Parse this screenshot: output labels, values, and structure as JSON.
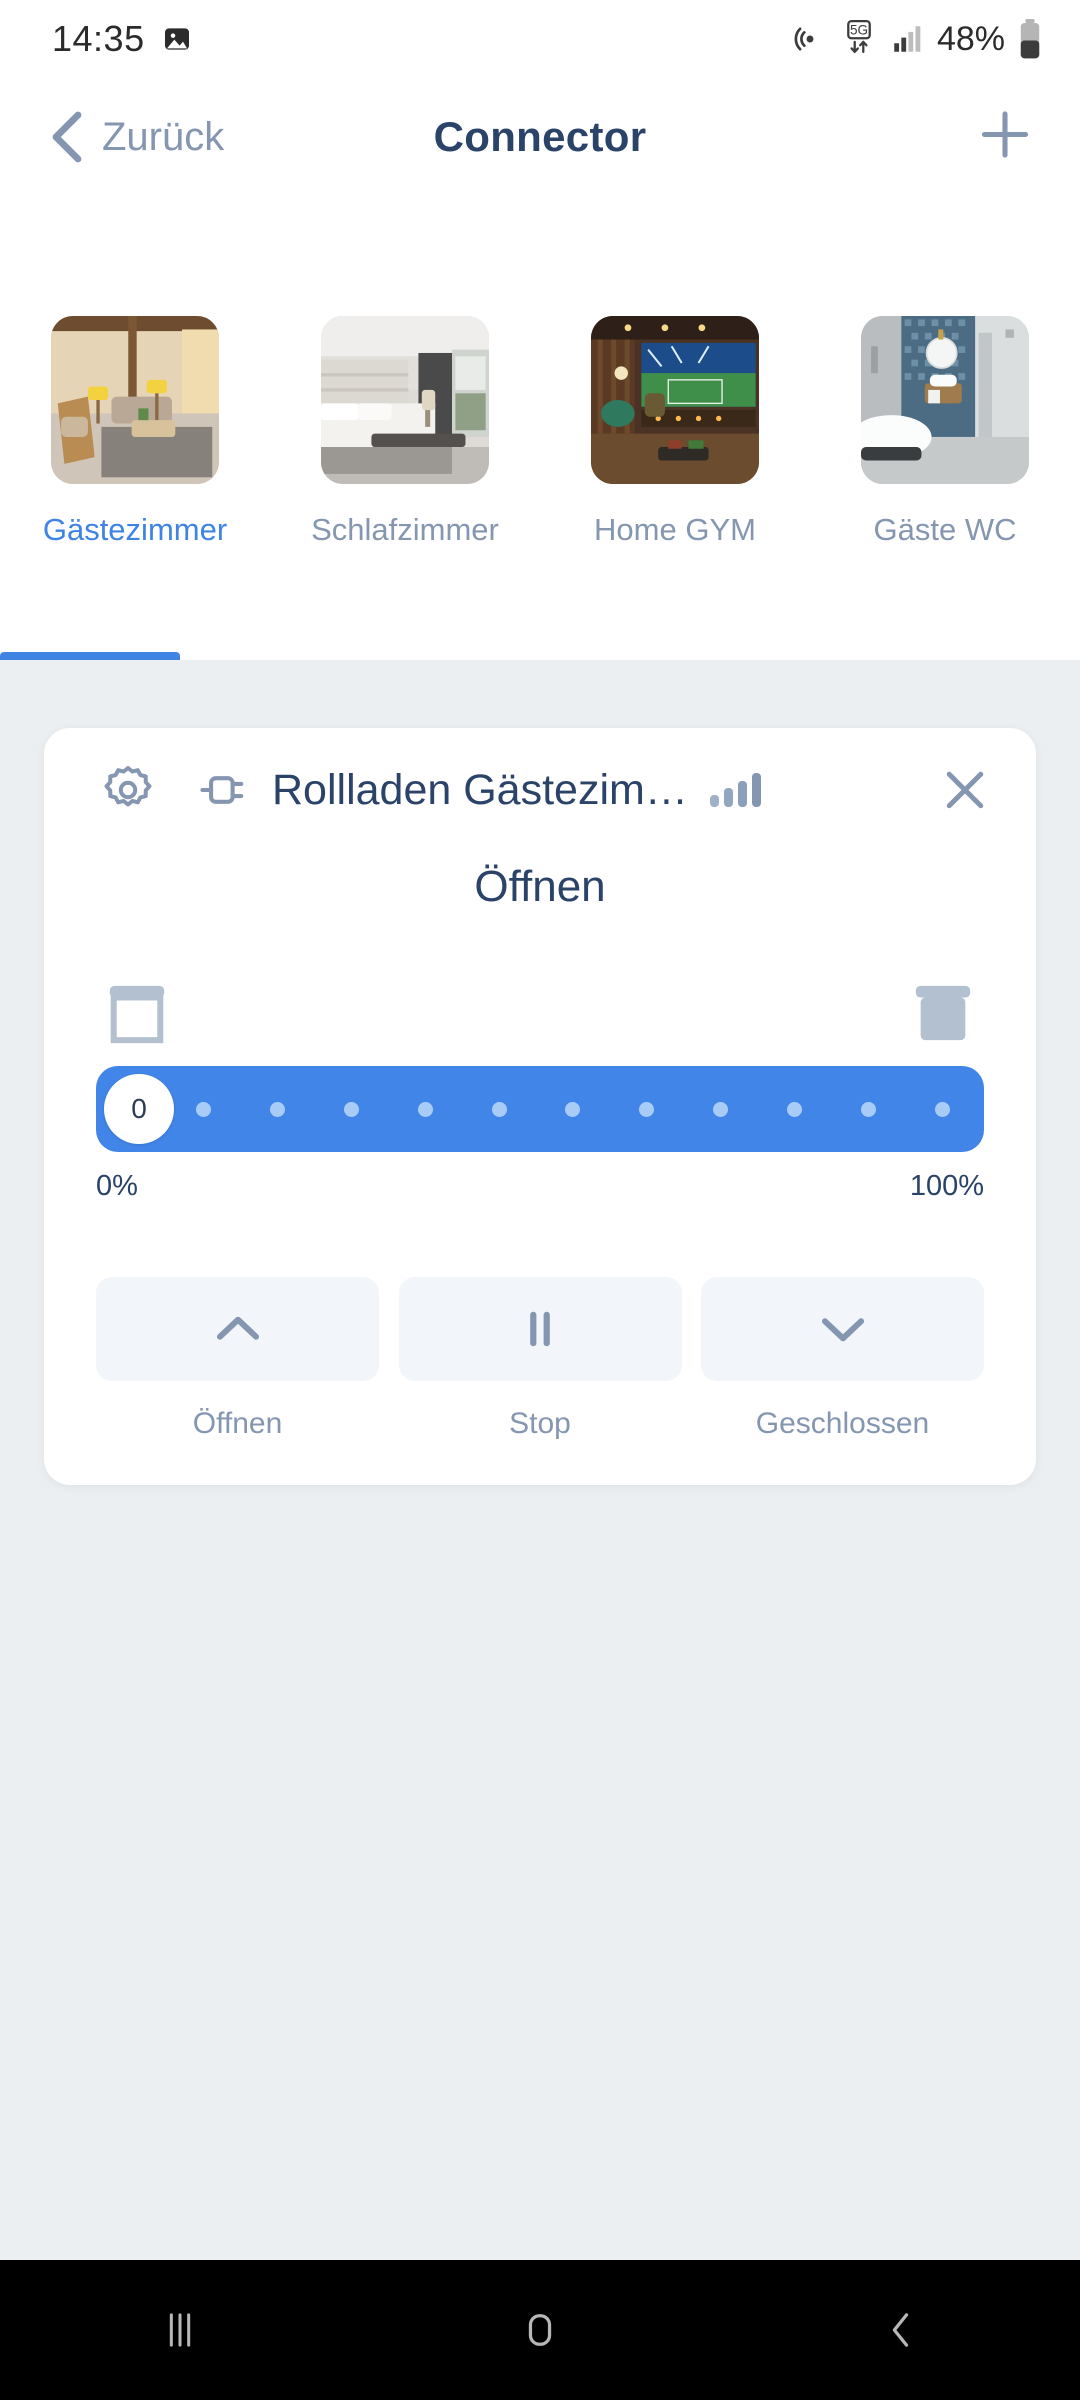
{
  "status_bar": {
    "time": "14:35",
    "battery_percent": "48%",
    "icons": [
      "image-icon",
      "hotspot-icon",
      "5g-icon",
      "signal-bars-icon",
      "battery-icon"
    ]
  },
  "header": {
    "back_label": "Zurück",
    "title": "Connector",
    "add_label": "+"
  },
  "rooms": [
    {
      "label": "Gästezimmer",
      "active": true,
      "thumb": "guest-room-photo"
    },
    {
      "label": "Schlafzimmer",
      "active": false,
      "thumb": "bedroom-photo"
    },
    {
      "label": "Home GYM",
      "active": false,
      "thumb": "home-gym-photo"
    },
    {
      "label": "Gäste WC",
      "active": false,
      "thumb": "guest-bathroom-photo"
    }
  ],
  "device_card": {
    "device_name": "Rollladen Gästezim…",
    "state_title": "Öffnen",
    "signal_bars": 4,
    "slider": {
      "value": "0",
      "min_label": "0%",
      "max_label": "100%",
      "tick_count": 11
    },
    "controls": [
      {
        "label": "Öffnen",
        "icon": "chevron-up-icon"
      },
      {
        "label": "Stop",
        "icon": "pause-icon"
      },
      {
        "label": "Geschlossen",
        "icon": "chevron-down-icon"
      }
    ]
  },
  "nav_bar": {
    "recents_label": "recents-icon",
    "home_label": "home-icon",
    "back_label": "back-icon"
  },
  "colors": {
    "accent_blue": "#3f84e4",
    "slider_blue": "#4285e8",
    "navy": "#2b4269",
    "muted": "#8496b0",
    "page_bg": "#eceff1"
  }
}
